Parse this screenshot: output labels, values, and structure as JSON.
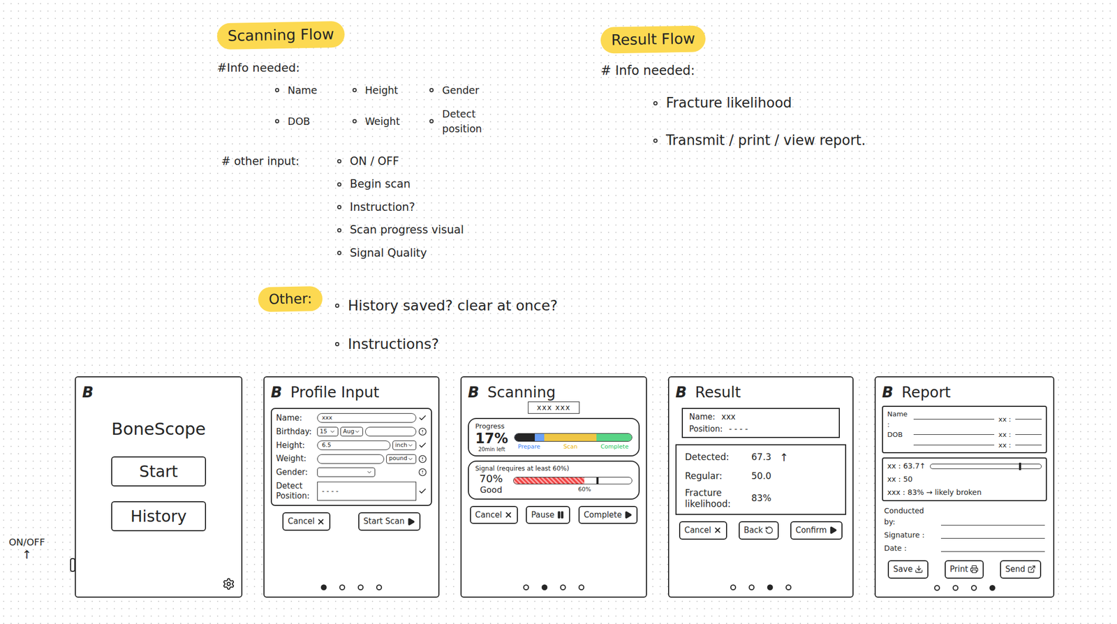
{
  "notes": {
    "scanning": {
      "title": "Scanning Flow",
      "info_label": "#Info needed:",
      "info_items": [
        "Name",
        "Height",
        "Gender",
        "DOB",
        "Weight",
        "Detect position"
      ],
      "input_label": "# other input:",
      "input_items": [
        "ON / OFF",
        "Begin scan",
        "Instruction?",
        "Scan progress visual",
        "Signal Quality"
      ]
    },
    "result": {
      "title": "Result Flow",
      "info_label": "# Info needed:",
      "info_items": [
        "Fracture likelihood",
        "Transmit / print / view report."
      ]
    },
    "other": {
      "title": "Other:",
      "items": [
        "History saved? clear at once?",
        "Instructions?"
      ]
    }
  },
  "logo": "B",
  "device": {
    "power_label": "ON/OFF",
    "power_arrow": "↑"
  },
  "home": {
    "title": "BoneScope",
    "buttons": [
      "Start",
      "History"
    ]
  },
  "profile": {
    "title": "Profile Input",
    "fields": [
      {
        "label": "Name:",
        "status": "ok",
        "controls": [
          {
            "kind": "input",
            "value": "xxx"
          }
        ]
      },
      {
        "label": "Birthday:",
        "status": "warn",
        "controls": [
          {
            "kind": "select",
            "value": "15"
          },
          {
            "kind": "select",
            "value": "Aug"
          },
          {
            "kind": "input",
            "value": ""
          }
        ]
      },
      {
        "label": "Height:",
        "status": "ok",
        "controls": [
          {
            "kind": "input",
            "value": "6.5"
          },
          {
            "kind": "select",
            "value": "inch"
          }
        ]
      },
      {
        "label": "Weight:",
        "status": "warn",
        "controls": [
          {
            "kind": "input",
            "value": ""
          },
          {
            "kind": "select",
            "value": "pound"
          }
        ]
      },
      {
        "label": "Gender:",
        "status": "warn",
        "controls": [
          {
            "kind": "select",
            "value": ""
          }
        ]
      },
      {
        "label": "Detect Position:",
        "status": "ok",
        "controls": [
          {
            "kind": "area",
            "value": "- - - -"
          }
        ]
      }
    ],
    "buttons": [
      {
        "label": "Cancel",
        "kind": "cancel"
      },
      {
        "label": "Start Scan",
        "kind": "play"
      }
    ],
    "dots": [
      {
        "selected": true
      },
      {
        "selected": false
      },
      {
        "selected": false
      },
      {
        "selected": false
      }
    ]
  },
  "scanning": {
    "title": "Scanning",
    "subtitle": "xxx xxx",
    "progress": {
      "label": "Progress",
      "reading": "17%",
      "remaining": "20min left",
      "level": 0.17,
      "stages": [
        {
          "label": "Prepare",
          "color": "#3b82f6",
          "share": 0.25
        },
        {
          "label": "Scan",
          "color": "#eab308",
          "share": 0.45
        },
        {
          "label": "Complete",
          "color": "#22c55e",
          "share": 0.3
        }
      ]
    },
    "signal": {
      "label": "Signal (requires at least 60%)",
      "reading": "70%",
      "quality": "Good",
      "level": 0.7,
      "threshold": 0.6,
      "threshold_label": "60%"
    },
    "buttons": [
      {
        "label": "Cancel",
        "kind": "cancel"
      },
      {
        "label": "Pause",
        "kind": "pause"
      },
      {
        "label": "Complete",
        "kind": "play"
      }
    ],
    "dots": [
      {
        "selected": false
      },
      {
        "selected": true
      },
      {
        "selected": false
      },
      {
        "selected": false
      }
    ]
  },
  "result": {
    "title": "Result",
    "patient": [
      {
        "label": "Name:",
        "value": "xxx"
      },
      {
        "label": "Position:",
        "value": "- - - -"
      }
    ],
    "metrics": [
      {
        "label": "Detected:",
        "value": "67.3",
        "trend": "↑"
      },
      {
        "label": "Regular:",
        "value": "50.0",
        "trend": ""
      },
      {
        "label": "Fracture likelihood:",
        "value": "83%",
        "trend": ""
      }
    ],
    "buttons": [
      {
        "label": "Cancel",
        "kind": "cancel"
      },
      {
        "label": "Back",
        "kind": "back"
      },
      {
        "label": "Confirm",
        "kind": "play"
      }
    ],
    "dots": [
      {
        "selected": false
      },
      {
        "selected": false
      },
      {
        "selected": true
      },
      {
        "selected": false
      }
    ]
  },
  "report": {
    "title": "Report",
    "info": [
      {
        "label": "Name :",
        "value": "xx :"
      },
      {
        "label": "DOB",
        "value": "xx :"
      },
      {
        "label": "",
        "value": "xx :"
      }
    ],
    "results": [
      {
        "text": "xx : 63.7↑",
        "level": 0.8
      },
      {
        "text": "xx : 50"
      },
      {
        "text": "xxx : 83% → likely broken"
      }
    ],
    "sign": [
      "Conducted by:",
      "Signature :",
      "Date :"
    ],
    "buttons": [
      {
        "label": "Save",
        "kind": "save"
      },
      {
        "label": "Print",
        "kind": "print"
      },
      {
        "label": "Send",
        "kind": "send"
      }
    ],
    "dots": [
      {
        "selected": false
      },
      {
        "selected": false
      },
      {
        "selected": false
      },
      {
        "selected": true
      }
    ]
  }
}
